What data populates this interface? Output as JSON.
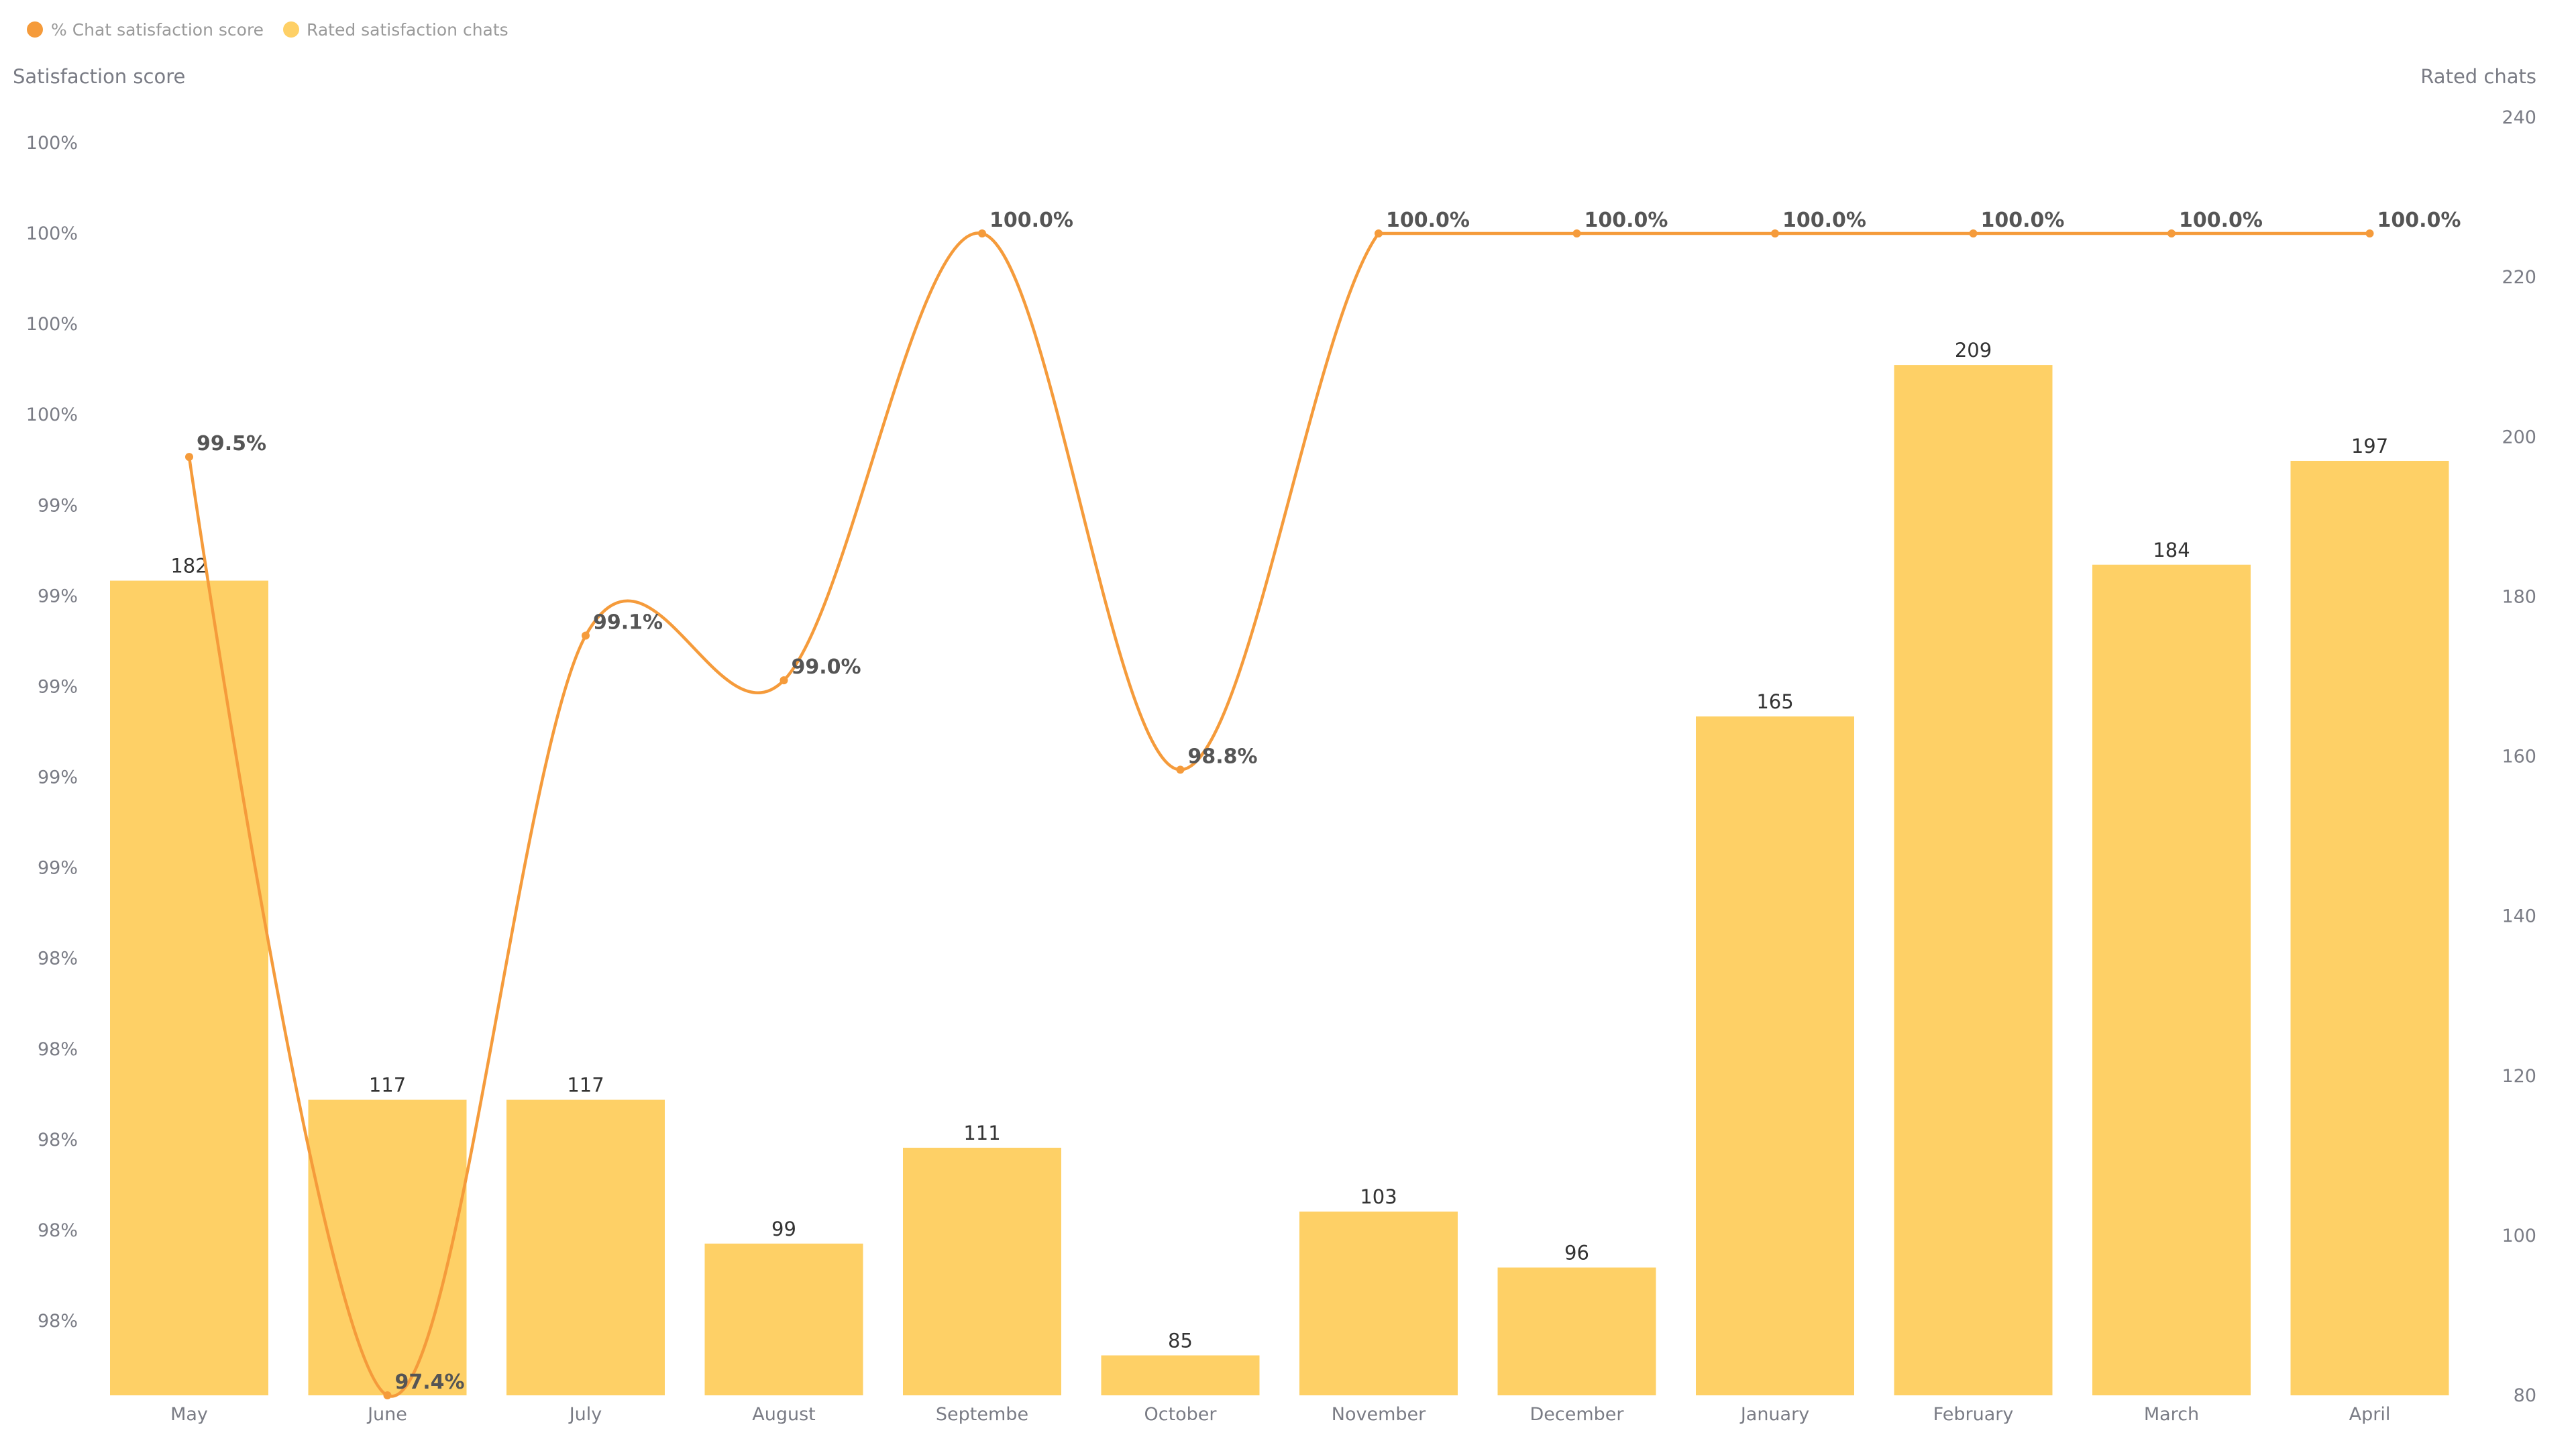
{
  "colors": {
    "line": "#F59B3B",
    "bar": "#FED066",
    "line_label": "#555555",
    "bar_label": "#333333",
    "axis_text": "#7a7c85",
    "legend_text": "#9a9a9a"
  },
  "chart_data": {
    "type": "bar+line",
    "categories": [
      "May",
      "June",
      "July",
      "August",
      "Septembe",
      "October",
      "November",
      "December",
      "January",
      "February",
      "March",
      "April"
    ],
    "series": [
      {
        "name": "% Chat satisfaction score",
        "type": "line",
        "axis": "left",
        "smooth": true,
        "values": [
          99.5,
          97.4,
          99.1,
          99.0,
          100.0,
          98.8,
          100.0,
          100.0,
          100.0,
          100.0,
          100.0,
          100.0
        ],
        "labels": [
          "99.5%",
          "97.4%",
          "99.1%",
          "99.0%",
          "100.0%",
          "98.8%",
          "100.0%",
          "100.0%",
          "100.0%",
          "100.0%",
          "100.0%",
          "100.0%"
        ]
      },
      {
        "name": "Rated satisfaction chats",
        "type": "bar",
        "axis": "right",
        "values": [
          182,
          117,
          117,
          99,
          111,
          85,
          103,
          96,
          165,
          209,
          184,
          197
        ],
        "labels": [
          "182",
          "117",
          "117",
          "99",
          "111",
          "85",
          "103",
          "96",
          "165",
          "209",
          "184",
          "197"
        ]
      }
    ],
    "legend": {
      "position": "top-left",
      "items": [
        "% Chat satisfaction score",
        "Rated satisfaction chats"
      ]
    },
    "left_axis": {
      "title": "Satisfaction score",
      "range": [
        97.4,
        100.4
      ],
      "tick_labels": [
        "100%",
        "100%",
        "100%",
        "100%",
        "99%",
        "99%",
        "99%",
        "99%",
        "99%",
        "98%",
        "98%",
        "98%",
        "98%",
        "98%"
      ]
    },
    "right_axis": {
      "title": "Rated chats",
      "range": [
        80,
        240
      ],
      "ticks": [
        240,
        220,
        200,
        180,
        160,
        140,
        120,
        100,
        80
      ],
      "tick_labels": [
        "240",
        "220",
        "200",
        "180",
        "160",
        "140",
        "120",
        "100",
        "80"
      ]
    },
    "grid": false
  }
}
